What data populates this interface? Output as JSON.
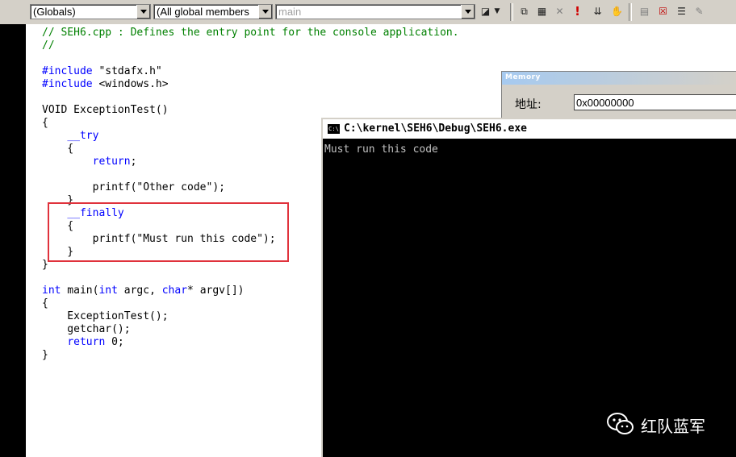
{
  "toolbar": {
    "scope_combo": "(Globals)",
    "members_combo": "(All global members",
    "function_combo": "main"
  },
  "editor": {
    "lines": [
      {
        "t": "// SEH6.cpp : Defines the entry point for the console application.",
        "c": "cm"
      },
      {
        "t": "//",
        "c": "cm"
      },
      {
        "t": "",
        "c": ""
      },
      {
        "t": "#include \"stdafx.h\"",
        "c": "inc"
      },
      {
        "t": "#include <windows.h>",
        "c": "inc"
      },
      {
        "t": "",
        "c": ""
      },
      {
        "t": "VOID ExceptionTest()",
        "c": ""
      },
      {
        "t": "{",
        "c": ""
      },
      {
        "t": "    __try",
        "c": "kw"
      },
      {
        "t": "    {",
        "c": ""
      },
      {
        "t": "        return;",
        "c": "kw"
      },
      {
        "t": "",
        "c": ""
      },
      {
        "t": "        printf(\"Other code\");",
        "c": ""
      },
      {
        "t": "    }",
        "c": ""
      },
      {
        "t": "    __finally",
        "c": "kw"
      },
      {
        "t": "    {",
        "c": ""
      },
      {
        "t": "        printf(\"Must run this code\");",
        "c": ""
      },
      {
        "t": "    }",
        "c": ""
      },
      {
        "t": "}",
        "c": ""
      },
      {
        "t": "",
        "c": ""
      },
      {
        "t": "int main(int argc, char* argv[])",
        "c": "main"
      },
      {
        "t": "{",
        "c": ""
      },
      {
        "t": "    ExceptionTest();",
        "c": ""
      },
      {
        "t": "    getchar();",
        "c": ""
      },
      {
        "t": "    return 0;",
        "c": "ret"
      },
      {
        "t": "}",
        "c": ""
      }
    ]
  },
  "memory_window": {
    "title": "Memory",
    "address_label": "地址:",
    "address_value": "0x00000000"
  },
  "console_window": {
    "title": "C:\\kernel\\SEH6\\Debug\\SEH6.exe",
    "output": "Must run this code"
  },
  "watermark": {
    "text": "红队蓝军"
  },
  "colors": {
    "keyword": "#0000ff",
    "comment": "#008000",
    "highlight_box": "#e0323c",
    "toolbar_bg": "#d4d0c8"
  }
}
